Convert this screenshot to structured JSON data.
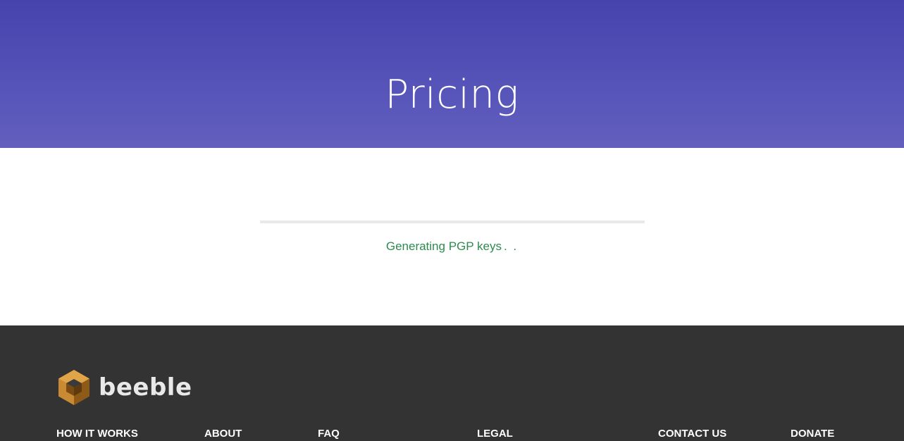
{
  "hero": {
    "title": "Pricing",
    "gradient": [
      "#4643ad",
      "#625fbe"
    ]
  },
  "progress": {
    "value": 0,
    "status_text": "Generating PGP keys",
    "dots": ". ."
  },
  "footer": {
    "brand": "beeble",
    "links": [
      {
        "label": "HOW IT WORKS"
      },
      {
        "label": "ABOUT"
      },
      {
        "label": "FAQ"
      },
      {
        "label": "LEGAL"
      },
      {
        "label": "CONTACT US"
      },
      {
        "label": "DONATE"
      }
    ]
  },
  "colors": {
    "accent_green": "#2f8a4f",
    "footer_bg": "#333333",
    "logo_amber": "#c8872f"
  }
}
